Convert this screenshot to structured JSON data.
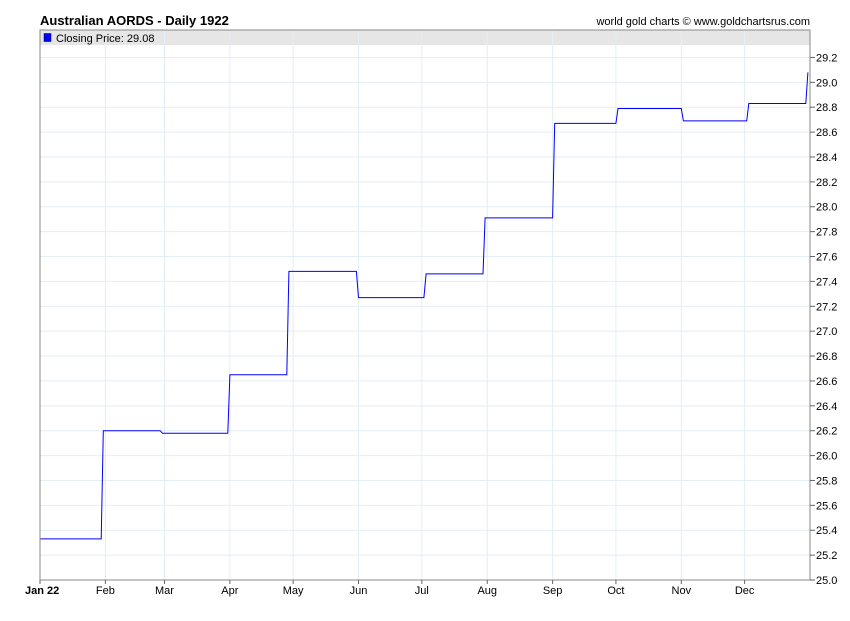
{
  "chart_data": {
    "type": "line",
    "title": "Australian AORDS - Daily 1922",
    "credit": "world gold charts © www.goldchartsrus.com",
    "legend": {
      "label": "Closing Price: 29.08",
      "position": "top-left",
      "color": "#0000ff"
    },
    "x_ticks": [
      {
        "day": 0,
        "label": "Jan 22"
      },
      {
        "day": 31,
        "label": "Feb"
      },
      {
        "day": 59,
        "label": "Mar"
      },
      {
        "day": 90,
        "label": "Apr"
      },
      {
        "day": 120,
        "label": "May"
      },
      {
        "day": 151,
        "label": "Jun"
      },
      {
        "day": 181,
        "label": "Jul"
      },
      {
        "day": 212,
        "label": "Aug"
      },
      {
        "day": 243,
        "label": "Sep"
      },
      {
        "day": 273,
        "label": "Oct"
      },
      {
        "day": 304,
        "label": "Nov"
      },
      {
        "day": 334,
        "label": "Dec"
      }
    ],
    "xlim": [
      0,
      365
    ],
    "ylim": [
      25.0,
      29.3
    ],
    "y_ticks": [
      25.0,
      25.2,
      25.4,
      25.6,
      25.8,
      26.0,
      26.2,
      26.4,
      26.6,
      26.8,
      27.0,
      27.2,
      27.4,
      27.6,
      27.8,
      28.0,
      28.2,
      28.4,
      28.6,
      28.8,
      29.0,
      29.2
    ],
    "grid": true,
    "series": [
      {
        "name": "Closing Price",
        "color": "#0000ff",
        "points": [
          [
            0,
            25.33
          ],
          [
            29,
            25.33
          ],
          [
            30,
            26.2
          ],
          [
            57,
            26.2
          ],
          [
            58,
            26.18
          ],
          [
            89,
            26.18
          ],
          [
            90,
            26.65
          ],
          [
            117,
            26.65
          ],
          [
            118,
            27.48
          ],
          [
            150,
            27.48
          ],
          [
            151,
            27.27
          ],
          [
            182,
            27.27
          ],
          [
            183,
            27.46
          ],
          [
            210,
            27.46
          ],
          [
            211,
            27.91
          ],
          [
            243,
            27.91
          ],
          [
            244,
            28.67
          ],
          [
            273,
            28.67
          ],
          [
            274,
            28.79
          ],
          [
            304,
            28.79
          ],
          [
            305,
            28.69
          ],
          [
            335,
            28.69
          ],
          [
            336,
            28.83
          ],
          [
            363,
            28.83
          ],
          [
            364,
            29.08
          ]
        ]
      }
    ]
  }
}
